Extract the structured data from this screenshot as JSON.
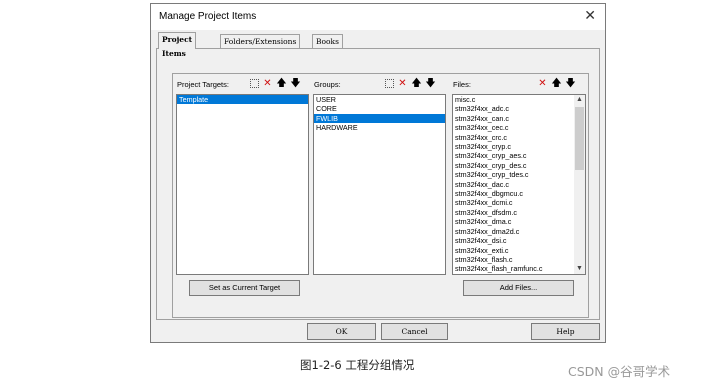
{
  "dialog": {
    "title": "Manage Project Items",
    "close_glyph": "✕"
  },
  "tabs": [
    {
      "label": "Project Items",
      "active": true
    },
    {
      "label": "Folders/Extensions",
      "active": false
    },
    {
      "label": "Books",
      "active": false
    }
  ],
  "targets": {
    "header": "Project Targets:",
    "items": [
      {
        "label": "Template",
        "selected": true
      }
    ]
  },
  "groups": {
    "header": "Groups:",
    "items": [
      {
        "label": "USER",
        "selected": false
      },
      {
        "label": "CORE",
        "selected": false
      },
      {
        "label": "FWLIB",
        "selected": true
      },
      {
        "label": "HARDWARE",
        "selected": false
      }
    ]
  },
  "files": {
    "header": "Files:",
    "items": [
      "misc.c",
      "stm32f4xx_adc.c",
      "stm32f4xx_can.c",
      "stm32f4xx_cec.c",
      "stm32f4xx_crc.c",
      "stm32f4xx_cryp.c",
      "stm32f4xx_cryp_aes.c",
      "stm32f4xx_cryp_des.c",
      "stm32f4xx_cryp_tdes.c",
      "stm32f4xx_dac.c",
      "stm32f4xx_dbgmcu.c",
      "stm32f4xx_dcmi.c",
      "stm32f4xx_dfsdm.c",
      "stm32f4xx_dma.c",
      "stm32f4xx_dma2d.c",
      "stm32f4xx_dsi.c",
      "stm32f4xx_exti.c",
      "stm32f4xx_flash.c",
      "stm32f4xx_flash_ramfunc.c"
    ]
  },
  "icons": {
    "new": "new-item-icon",
    "delete": "✕",
    "up": "🡅",
    "down": "🡇"
  },
  "buttons": {
    "set_current": "Set as Current Target",
    "add_files": "Add Files...",
    "ok": "OK",
    "cancel": "Cancel",
    "help": "Help"
  },
  "caption": "图1-2-6    工程分组情况",
  "watermark": "CSDN @谷哥学术"
}
